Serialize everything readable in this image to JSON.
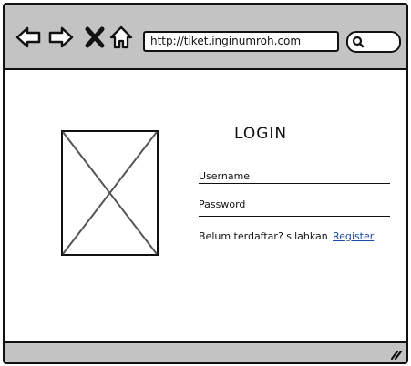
{
  "browser": {
    "url": "http://tiket.inginumroh.com",
    "icons": {
      "back": "arrow-left-icon",
      "forward": "arrow-right-icon",
      "stop": "close-icon",
      "home": "home-icon",
      "search": "search-icon"
    }
  },
  "login": {
    "title": "LOGIN",
    "username_label": "Username",
    "password_label": "Password",
    "register_prompt": "Belum terdaftar? silahkan",
    "register_link": "Register"
  },
  "colors": {
    "chrome": "#c3c3c3",
    "link": "#1a4fa3",
    "stroke": "#111111"
  }
}
